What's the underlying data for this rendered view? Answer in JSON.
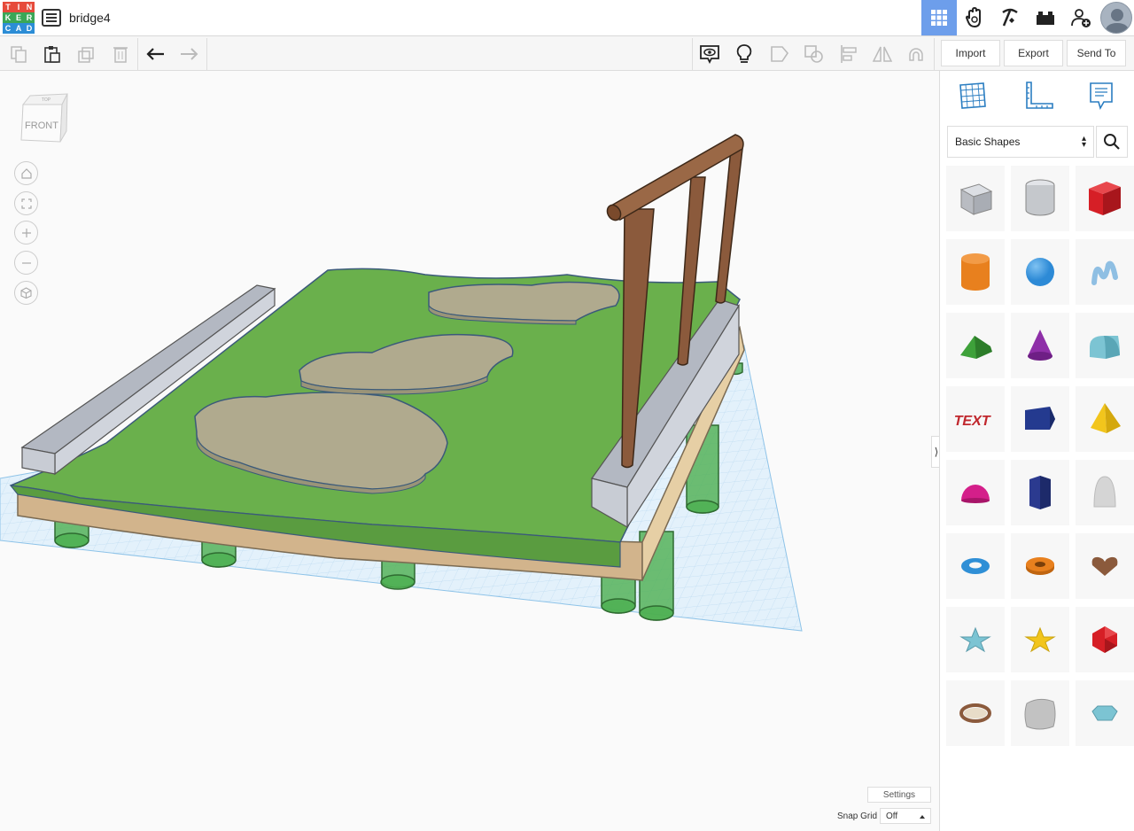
{
  "app": {
    "logo_letters": [
      "T",
      "I",
      "N",
      "K",
      "E",
      "R",
      "C",
      "A",
      "D"
    ],
    "logo_colors": [
      "#e64b3b",
      "#e64b3b",
      "#e64b3b",
      "#3aa757",
      "#3aa757",
      "#3aa757",
      "#2c8dd6",
      "#2c8dd6",
      "#2c8dd6"
    ],
    "document_title": "bridge4"
  },
  "topbar": {
    "icons": [
      "grid-view-icon",
      "tinker-hand-icon",
      "pickaxe-icon",
      "bricks-icon",
      "add-user-icon",
      "avatar"
    ],
    "active_color": "#6d9eeb"
  },
  "toolbar": {
    "tools": [
      "copy-icon",
      "paste-icon",
      "duplicate-icon",
      "delete-icon",
      "undo-icon",
      "redo-icon"
    ],
    "view_tools": [
      "notes-visibility-icon",
      "lightbulb-icon",
      "group-icon",
      "ungroup-icon",
      "align-icon",
      "mirror-icon",
      "magnet-icon"
    ],
    "import_label": "Import",
    "export_label": "Export",
    "send_to_label": "Send To"
  },
  "viewport": {
    "viewcube_face": "FRONT",
    "viewcube_top": "TOP",
    "nav": [
      "home-icon",
      "fit-icon",
      "zoom-in-icon",
      "zoom-out-icon",
      "ortho-icon"
    ],
    "settings_label": "Settings",
    "snap_grid_label": "Snap Grid",
    "snap_grid_value": "Off",
    "colors": {
      "grass": "#6ab04c",
      "stone": "#b0aa8e",
      "wall": "#c7cbd3",
      "wood_post": "#8b5a3c",
      "dirt": "#d2b48c",
      "pillar": "#4caf50",
      "workplane": "#d6eaf8"
    }
  },
  "panel": {
    "tabs": [
      "workplane-icon",
      "ruler-icon",
      "notes-icon"
    ],
    "shape_category": "Basic Shapes",
    "shapes": [
      {
        "name": "box-hole",
        "color": "#b9bcc2"
      },
      {
        "name": "cylinder-hole",
        "color": "#c5c8cc"
      },
      {
        "name": "box",
        "color": "#d61f26"
      },
      {
        "name": "cylinder",
        "color": "#e8801e"
      },
      {
        "name": "sphere",
        "color": "#2d8ad6"
      },
      {
        "name": "scribble",
        "color": "#8fbfe3"
      },
      {
        "name": "roof",
        "color": "#3ea13a"
      },
      {
        "name": "cone",
        "color": "#8e2fa8"
      },
      {
        "name": "round-roof",
        "color": "#7cc4d3"
      },
      {
        "name": "text",
        "color": "#c0272d"
      },
      {
        "name": "prism",
        "color": "#243a8f"
      },
      {
        "name": "pyramid",
        "color": "#f2c51c"
      },
      {
        "name": "half-sphere",
        "color": "#d41f8a"
      },
      {
        "name": "polygon",
        "color": "#2b3a8f"
      },
      {
        "name": "paraboloid",
        "color": "#d5d5d5"
      },
      {
        "name": "torus",
        "color": "#2f8fd6"
      },
      {
        "name": "tube",
        "color": "#e8801e"
      },
      {
        "name": "heart",
        "color": "#8b5a3c"
      },
      {
        "name": "star",
        "color": "#7cc4d3"
      },
      {
        "name": "star-yellow",
        "color": "#f2c51c"
      },
      {
        "name": "icosahedron",
        "color": "#d61f26"
      },
      {
        "name": "ring",
        "color": "#8b5a3c"
      },
      {
        "name": "rounded-box",
        "color": "#c2c2c2"
      },
      {
        "name": "gem",
        "color": "#7cc4d3"
      }
    ]
  }
}
